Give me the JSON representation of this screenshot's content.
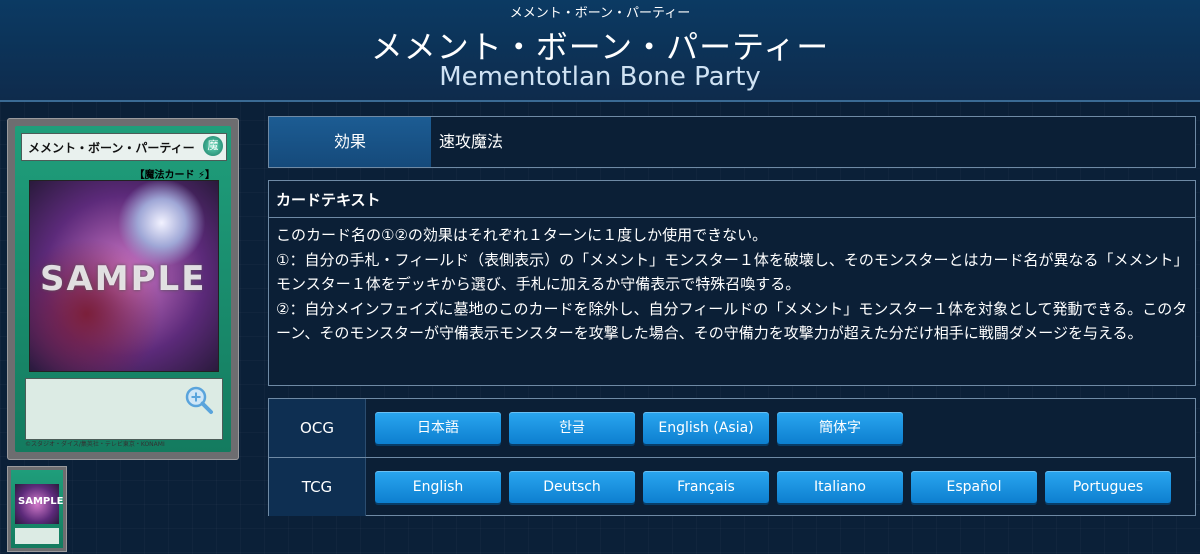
{
  "header": {
    "ruby": "メメント・ボーン・パーティー",
    "name_ja": "メメント・ボーン・パーティー",
    "name_en": "Mementotlan Bone Party"
  },
  "card_image": {
    "name_text": "メメント・ボーン・パーティー",
    "attribute": "魔",
    "type_line": "【魔法カード ⚡】",
    "sample_label": "SAMPLE",
    "footer": "©スタジオ・ダイス/集英社・テレビ東京・KONAMI",
    "thumb_sample": "SAMPLE"
  },
  "effect": {
    "label": "効果",
    "value": "速攻魔法"
  },
  "card_text": {
    "title": "カードテキスト",
    "body": "このカード名の①②の効果はそれぞれ１ターンに１度しか使用できない。\n①：自分の手札・フィールド（表側表示）の「メメント」モンスター１体を破壊し、そのモンスターとはカード名が異なる「メメント」モンスター１体をデッキから選び、手札に加えるか守備表示で特殊召喚する。\n②：自分メインフェイズに墓地のこのカードを除外し、自分フィールドの「メメント」モンスター１体を対象として発動できる。このターン、そのモンスターが守備表示モンスターを攻撃した場合、その守備力を攻撃力が超えた分だけ相手に戦闘ダメージを与える。"
  },
  "languages": {
    "ocg": {
      "label": "OCG",
      "buttons": [
        "日本語",
        "한글",
        "English (Asia)",
        "簡体字"
      ]
    },
    "tcg": {
      "label": "TCG",
      "buttons": [
        "English",
        "Deutsch",
        "Français",
        "Italiano",
        "Español",
        "Portugues"
      ]
    }
  }
}
